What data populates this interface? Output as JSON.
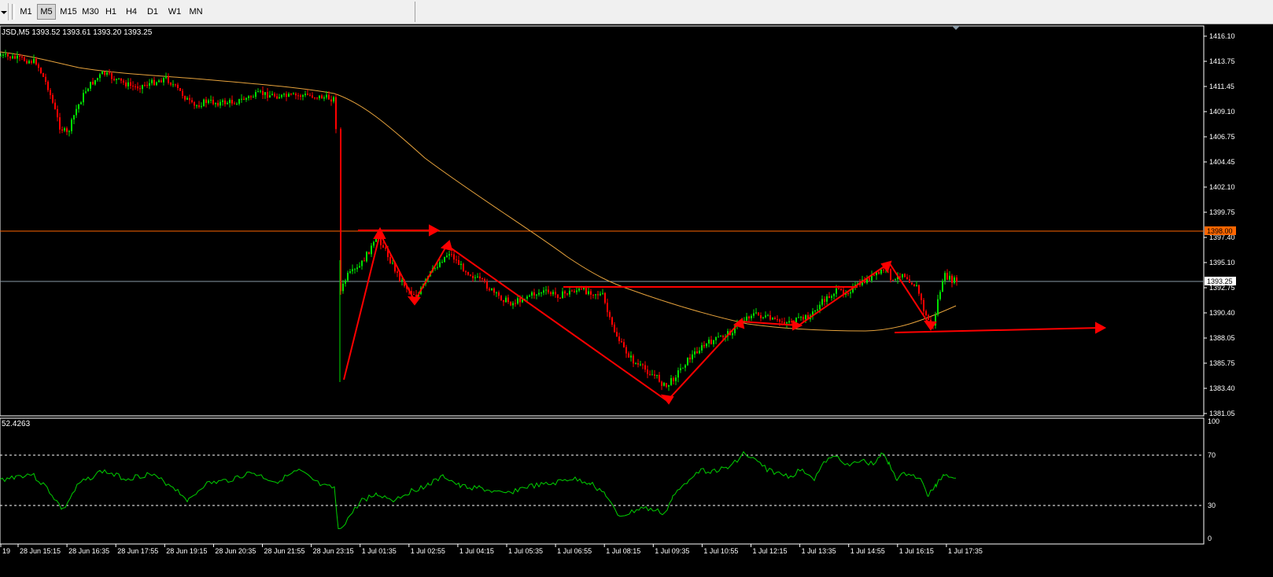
{
  "toolbar": {
    "timeframes": [
      {
        "label": "M1",
        "active": false
      },
      {
        "label": "M5",
        "active": true
      },
      {
        "label": "M15",
        "active": false
      },
      {
        "label": "M30",
        "active": false
      },
      {
        "label": "H1",
        "active": false
      },
      {
        "label": "H4",
        "active": false
      },
      {
        "label": "D1",
        "active": false
      },
      {
        "label": "W1",
        "active": false
      },
      {
        "label": "MN",
        "active": false
      }
    ]
  },
  "price_chart": {
    "header": "JSD,M5  1393.52 1393.61 1393.20 1393.25",
    "price_ticks": [
      "1416.10",
      "1413.75",
      "1411.45",
      "1409.10",
      "1406.75",
      "1404.45",
      "1402.10",
      "1399.75",
      "1397.40",
      "1395.10",
      "1392.75",
      "1390.40",
      "1388.05",
      "1385.75",
      "1383.40",
      "1381.05"
    ],
    "resistance_label": "1398.00",
    "current_price_label": "1393.25",
    "colors": {
      "bull": "#00e000",
      "bear": "#ff0000",
      "ma": "#e6a23c",
      "resistance": "#ff6600",
      "current_line": "#8a9aa6",
      "annotation": "#ff0000",
      "grid_text": "#ffffff"
    }
  },
  "rsi_panel": {
    "header": "52.4263",
    "levels": [
      "100",
      "70",
      "30",
      "0"
    ],
    "line_color": "#00d000"
  },
  "time_axis": {
    "labels": [
      "19",
      "28 Jun 15:15",
      "28 Jun 16:35",
      "28 Jun 17:55",
      "28 Jun 19:15",
      "28 Jun 20:35",
      "28 Jun 21:55",
      "28 Jun 23:15",
      "1 Jul 01:35",
      "1 Jul 02:55",
      "1 Jul 04:15",
      "1 Jul 05:35",
      "1 Jul 06:55",
      "1 Jul 08:15",
      "1 Jul 09:35",
      "1 Jul 10:55",
      "1 Jul 12:15",
      "1 Jul 13:35",
      "1 Jul 14:55",
      "1 Jul 16:15",
      "1 Jul 17:35"
    ]
  },
  "chart_data": {
    "type": "candlestick",
    "symbol_timeframe": "M5",
    "ylim": [
      1381.05,
      1416.1
    ],
    "last_ohlc": {
      "open": 1393.52,
      "high": 1393.61,
      "low": 1393.2,
      "close": 1393.25
    },
    "horizontal_levels": [
      1398.0,
      1393.25
    ],
    "rsi": {
      "last": 52.4263,
      "ylim": [
        0,
        100
      ],
      "levels": [
        70,
        30
      ]
    }
  }
}
